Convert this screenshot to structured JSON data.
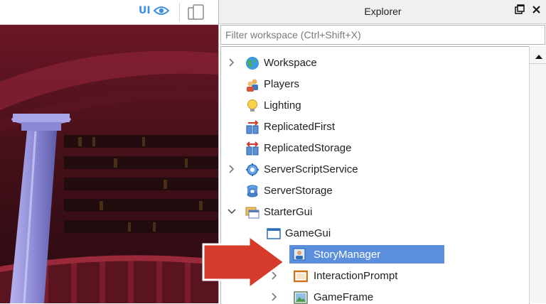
{
  "toolbar": {
    "ui_label": "UI"
  },
  "explorer": {
    "title": "Explorer",
    "filter_placeholder": "Filter workspace (Ctrl+Shift+X)",
    "items": [
      {
        "label": "Workspace",
        "icon": "globe-icon",
        "twisty": "collapsed"
      },
      {
        "label": "Players",
        "icon": "players-icon",
        "twisty": "none"
      },
      {
        "label": "Lighting",
        "icon": "lightbulb-icon",
        "twisty": "none"
      },
      {
        "label": "ReplicatedFirst",
        "icon": "replicated-first-icon",
        "twisty": "none"
      },
      {
        "label": "ReplicatedStorage",
        "icon": "replicated-storage-icon",
        "twisty": "none"
      },
      {
        "label": "ServerScriptService",
        "icon": "server-script-service-icon",
        "twisty": "collapsed"
      },
      {
        "label": "ServerStorage",
        "icon": "server-storage-icon",
        "twisty": "none"
      },
      {
        "label": "StarterGui",
        "icon": "starter-gui-icon",
        "twisty": "expanded"
      },
      {
        "label": "GameGui",
        "icon": "screen-gui-icon",
        "twisty": "none"
      },
      {
        "label": "StoryManager",
        "icon": "local-script-icon",
        "twisty": "none",
        "selected": true
      },
      {
        "label": "InteractionPrompt",
        "icon": "frame-icon",
        "twisty": "collapsed"
      },
      {
        "label": "GameFrame",
        "icon": "image-frame-icon",
        "twisty": "collapsed"
      }
    ]
  },
  "colors": {
    "selection": "#5b8fde",
    "accent": "#3d8fe0",
    "arrow": "#d63a2b"
  }
}
